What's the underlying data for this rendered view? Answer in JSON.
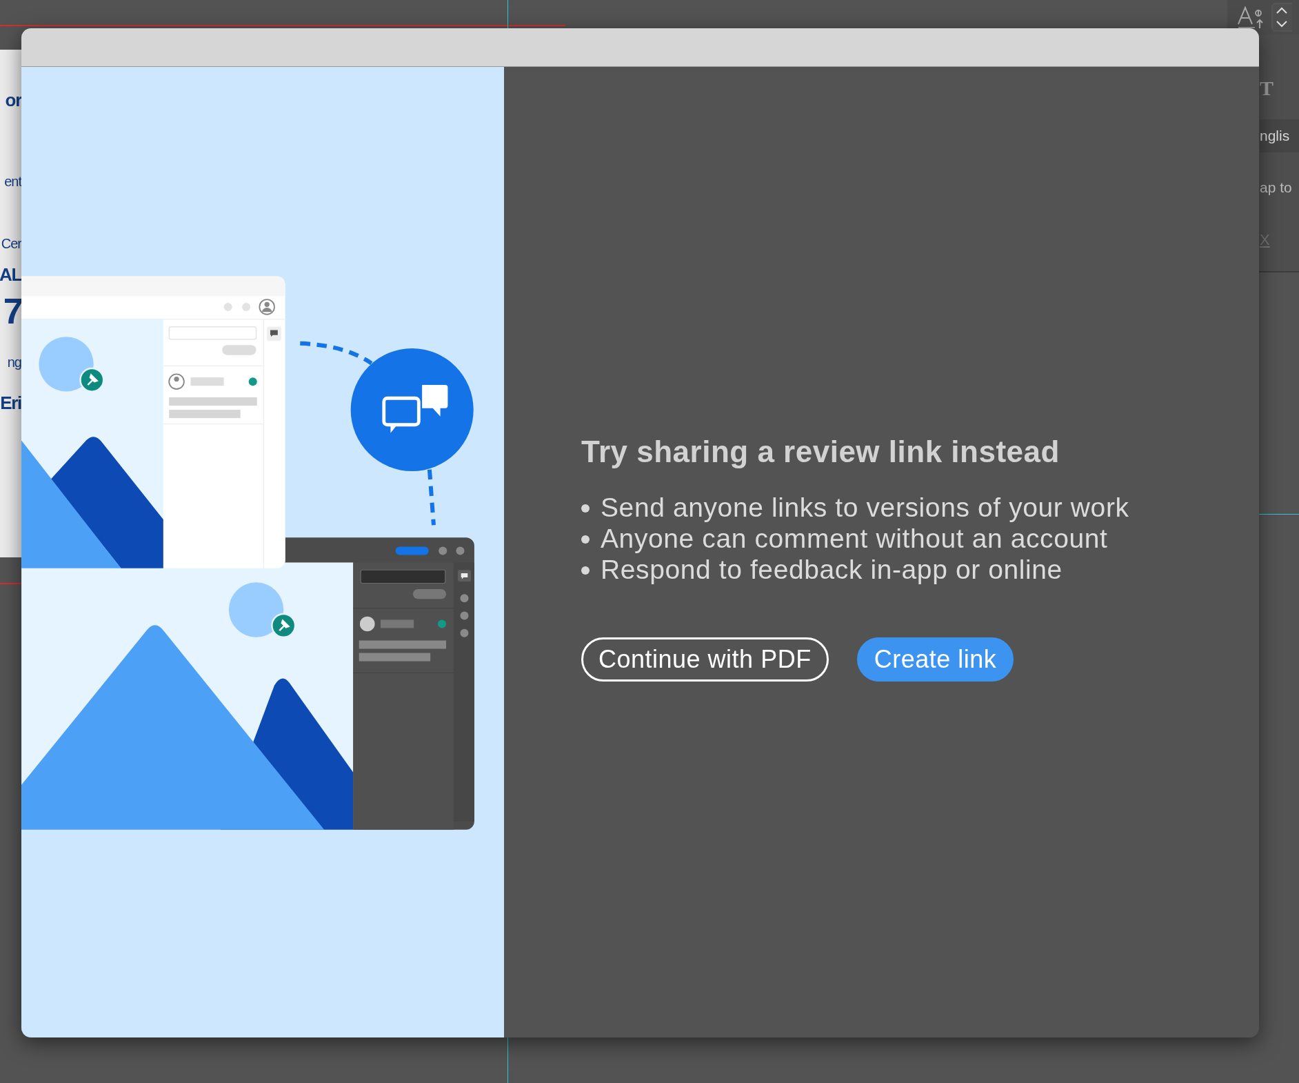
{
  "background_document": {
    "fragments": [
      {
        "text": "or",
        "kind": "bold"
      },
      {
        "text": "ent",
        "kind": "regular"
      },
      {
        "text": "Cer",
        "kind": "regular"
      },
      {
        "text": "AL",
        "kind": "bold"
      },
      {
        "text": "7",
        "kind": "numeral"
      },
      {
        "text": "ng",
        "kind": "regular"
      },
      {
        "text": "Eri",
        "kind": "bold"
      }
    ]
  },
  "right_panel": {
    "rows": [
      {
        "text": "T",
        "kind": "glyph"
      },
      {
        "text": "nglis",
        "kind": "field"
      },
      {
        "text": "ap to",
        "kind": "label"
      },
      {
        "text": "X",
        "kind": "disabled"
      }
    ]
  },
  "dialog": {
    "heading": "Try sharing a review link instead",
    "bullets": [
      "Send anyone links to versions of your work",
      "Anyone can comment without an account",
      "Respond to feedback in-app or online"
    ],
    "buttons": [
      {
        "label": "Continue with PDF",
        "kind": "secondary"
      },
      {
        "label": "Create link",
        "kind": "primary"
      }
    ]
  }
}
